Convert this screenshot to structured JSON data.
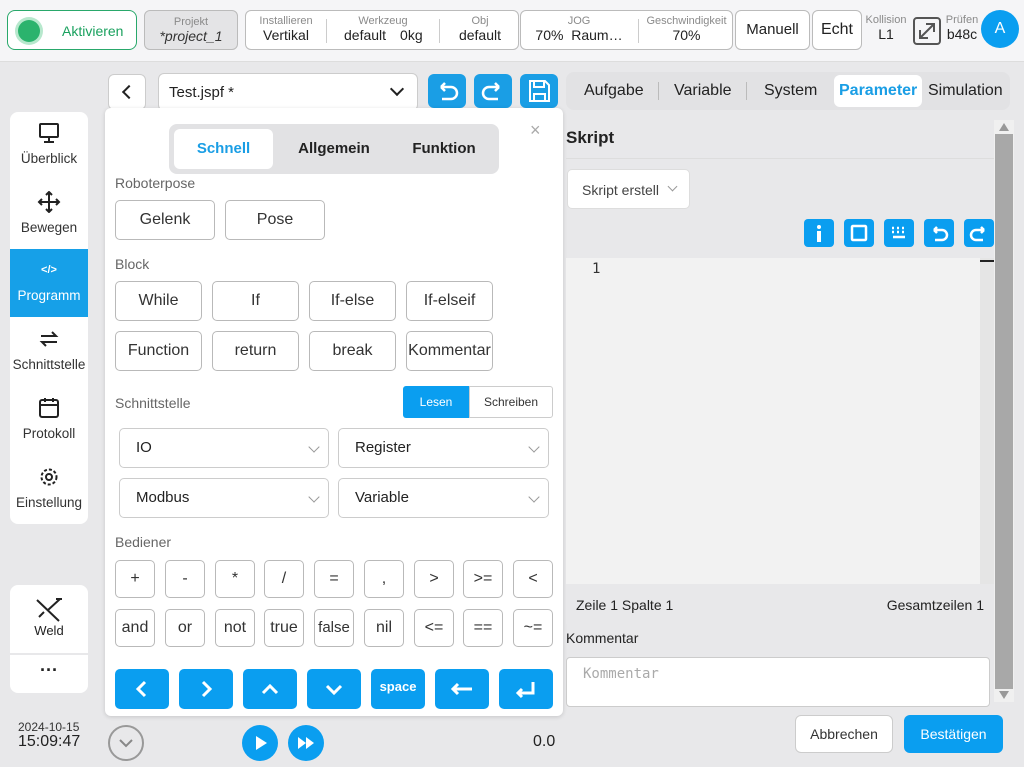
{
  "topbar": {
    "activate": "Aktivieren",
    "project_cap": "Projekt",
    "project_val": "*project_1",
    "install_cap": "Installieren",
    "install_val": "Vertikal",
    "tool_cap": "Werkzeug",
    "tool_val": "default",
    "tool_mass": "0kg",
    "obj_cap": "Obj",
    "obj_val": "default",
    "jog_cap": "JOG",
    "jog_pct": "70%",
    "jog_mode": "Raum…",
    "speed_cap": "Geschwindigkeit",
    "speed_val": "70%",
    "mode": "Manuell",
    "real": "Echt",
    "collision_cap": "Kollision",
    "collision_val": "L1",
    "check_cap": "Prüfen",
    "check_val": "b48c",
    "avatar": "A"
  },
  "sidebar": {
    "items": [
      {
        "label": "Überblick"
      },
      {
        "label": "Bewegen"
      },
      {
        "label": "Programm"
      },
      {
        "label": "Schnittstelle"
      },
      {
        "label": "Protokoll"
      },
      {
        "label": "Einstellung"
      }
    ],
    "weld": "Weld",
    "more": "···",
    "date": "2024-10-15",
    "time": "15:09:47"
  },
  "editor": {
    "file": "Test.jspf *",
    "tabs": [
      "Schnell",
      "Allgemein",
      "Funktion"
    ],
    "section_pose": "Roboterpose",
    "pose_buttons": [
      "Gelenk",
      "Pose"
    ],
    "section_block": "Block",
    "block_row1": [
      "While",
      "If",
      "If-else",
      "If-elseif"
    ],
    "block_row2": [
      "Function",
      "return",
      "break",
      "Kommentar"
    ],
    "section_interface": "Schnittstelle",
    "read": "Lesen",
    "write": "Schreiben",
    "drops": [
      "IO",
      "Register",
      "Modbus",
      "Variable"
    ],
    "section_ops": "Bediener",
    "ops_row1": [
      "+",
      "-",
      "*",
      "/",
      "=",
      ",",
      ">",
      ">=",
      "<"
    ],
    "ops_row2": [
      "and",
      "or",
      "not",
      "true",
      "false",
      "nil",
      "<=",
      "==",
      "~="
    ],
    "space": "space",
    "close": "×",
    "speed_value": "0.0"
  },
  "right": {
    "tabs": [
      "Aufgabe",
      "Variable",
      "System",
      "Parameter",
      "Simulation"
    ],
    "active_tab": "Parameter",
    "title": "Skript",
    "script_select": "Skript erstell",
    "line_number": "1",
    "position": "Zeile 1 Spalte 1",
    "total_lines": "Gesamtzeilen 1",
    "comment_label": "Kommentar",
    "comment_placeholder": "Kommentar",
    "cancel": "Abbrechen",
    "confirm": "Bestätigen"
  },
  "colors": {
    "accent": "#0a9ef0",
    "active_green": "#2bb36d"
  }
}
